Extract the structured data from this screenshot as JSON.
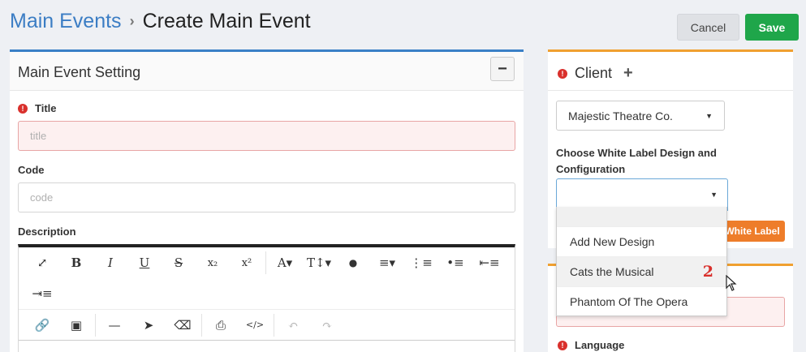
{
  "breadcrumb": {
    "parent": "Main Events",
    "separator": "›",
    "current": "Create Main Event"
  },
  "actions": {
    "cancel": "Cancel",
    "save": "Save"
  },
  "main_setting": {
    "title": "Main Event Setting",
    "collapse": "−",
    "fields": {
      "title_label": "Title",
      "title_placeholder": "title",
      "code_label": "Code",
      "code_placeholder": "code",
      "description_label": "Description"
    },
    "toolbar": {
      "row1": [
        "⤢",
        "B",
        "I",
        "U",
        "S",
        "x₂",
        "x²",
        "A▾",
        "T↕▾",
        "●",
        "≡▾",
        "⋮≡",
        "•≡",
        "⇤≡"
      ],
      "row2": [
        "⇥≡"
      ],
      "row3": [
        "🔗",
        "▣",
        "—",
        "➤",
        "⌫",
        "⎙",
        "</>",
        "↶",
        "↷"
      ]
    }
  },
  "client": {
    "title": "Client",
    "add": "+",
    "selected_client": "Majestic Theatre Co.",
    "white_label_label": "Choose White Label Design and Configuration",
    "white_label_button": "White Label",
    "dropdown_options": [
      "Add New Design",
      "Cats the Musical",
      "Phantom Of The Opera"
    ],
    "hover_badge": "2"
  },
  "lower_panel": {
    "language_label": "Language"
  },
  "colors": {
    "primary_blue": "#3a80c6",
    "save_green": "#1fa64a",
    "warning_orange": "#f0a030",
    "error_red": "#d9302c"
  }
}
